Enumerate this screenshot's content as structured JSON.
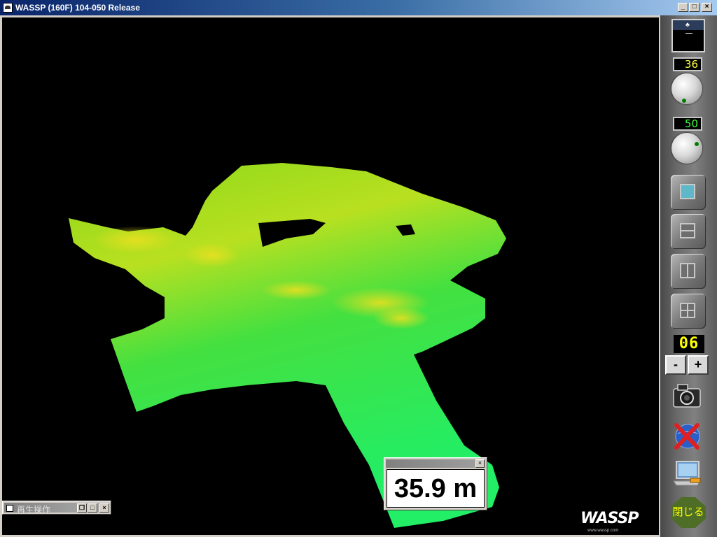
{
  "window": {
    "title": "WASSP (160F) 104-050  Release"
  },
  "depth_readout": {
    "value": "35.9 m"
  },
  "playback_window": {
    "title": "再生操作"
  },
  "sidebar": {
    "gain_value": "36",
    "gain_color": "#ffff40",
    "range_value": "50",
    "range_color": "#40ff40",
    "counter_value": "06",
    "counter_color": "#ffff00",
    "minus_label": "-",
    "plus_label": "+",
    "close_label": "閉じる"
  },
  "branding": {
    "logo": "WASSP",
    "url": "www.wassp.com"
  },
  "colors": {
    "terrain_green": "#22dd33",
    "terrain_yellow": "#ddee22",
    "accent_blue": "#0a246a"
  }
}
